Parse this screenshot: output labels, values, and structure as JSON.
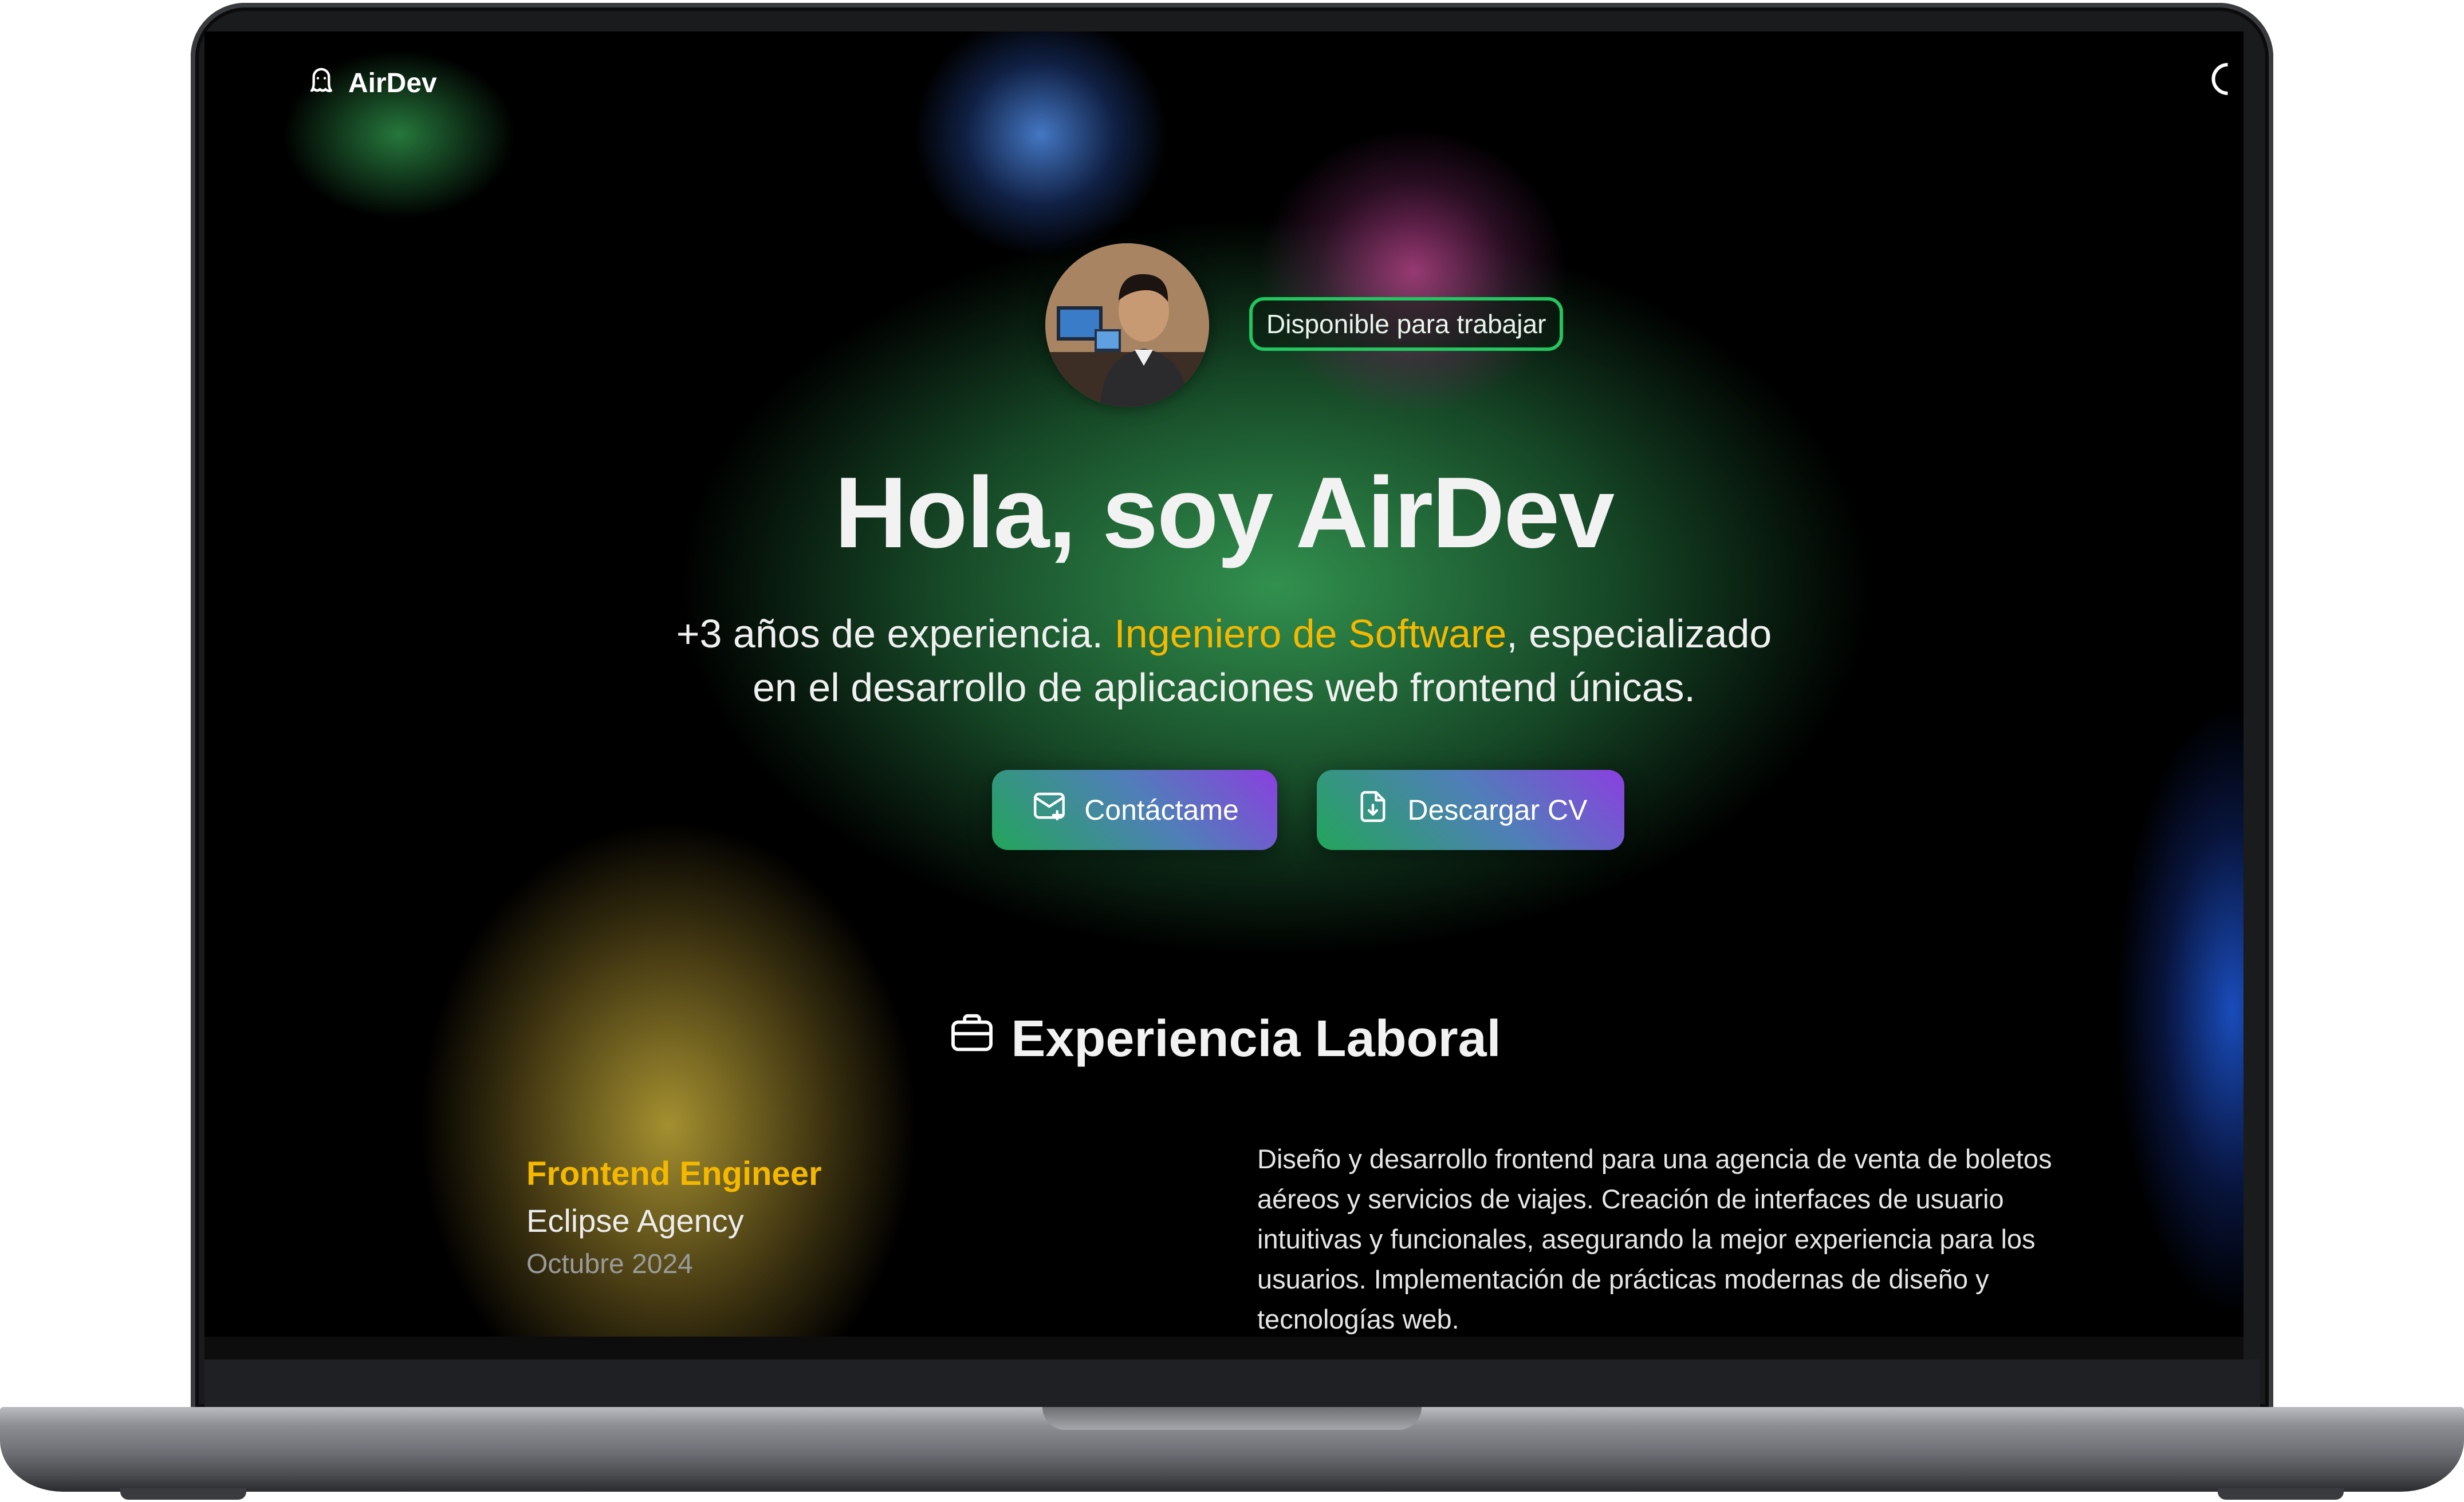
{
  "nav": {
    "logo_text": "AirDev",
    "logo_icon": "ghost-icon",
    "theme_toggle_icon": "moon-icon"
  },
  "hero": {
    "status_badge": "Disponible para trabajar",
    "title": "Hola, soy AirDev",
    "subtitle_prefix": "+3 años de experiencia. ",
    "subtitle_highlight": "Ingeniero de Software",
    "subtitle_suffix": ", especializado en el desarrollo de aplicaciones web frontend únicas.",
    "buttons": {
      "contact_label": "Contáctame",
      "contact_icon": "mail-plus-icon",
      "cv_label": "Descargar CV",
      "cv_icon": "file-download-icon"
    }
  },
  "experience": {
    "section_title": "Experiencia Laboral",
    "section_icon": "briefcase-icon",
    "jobs": [
      {
        "role": "Frontend Engineer",
        "company": "Eclipse Agency",
        "date": "Octubre 2024",
        "description": "Diseño y desarrollo frontend para una agencia de venta de boletos aéreos y servicios de viajes. Creación de interfaces de usuario intuitivas y funcionales, asegurando la mejor experiencia para los usuarios. Implementación de prácticas modernas de diseño y tecnologías web."
      }
    ]
  },
  "colors": {
    "accent_yellow": "#f5b800",
    "badge_green": "#22c55e",
    "button_gradient_start": "#22a55a",
    "button_gradient_end": "#8b3fe0",
    "background": "#000000"
  }
}
